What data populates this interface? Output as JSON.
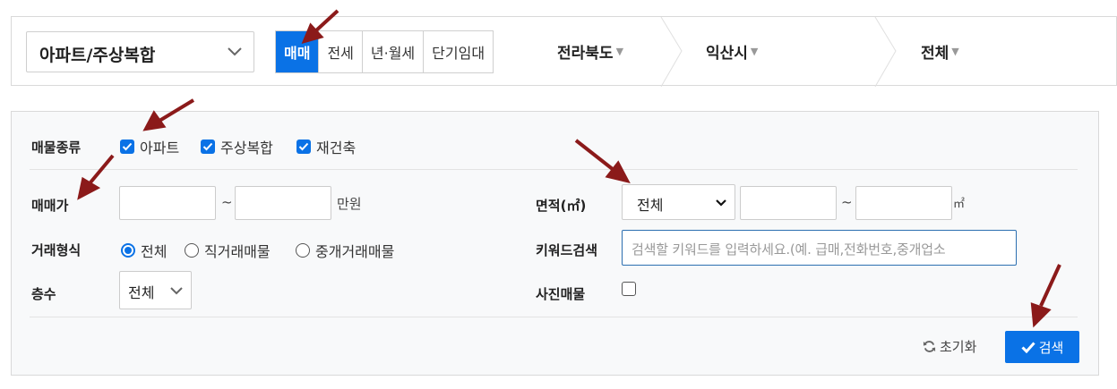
{
  "top": {
    "property_type": "아파트/주상복합",
    "deal_tabs": [
      "매매",
      "전세",
      "년·월세",
      "단기임대"
    ],
    "active_tab": "매매",
    "region": {
      "province": "전라북도",
      "city": "익산시",
      "district": "전체"
    }
  },
  "filters": {
    "property_kind": {
      "label": "매물종류",
      "options": [
        {
          "label": "아파트",
          "checked": true
        },
        {
          "label": "주상복합",
          "checked": true
        },
        {
          "label": "재건축",
          "checked": true
        }
      ]
    },
    "price": {
      "label": "매매가",
      "min": "",
      "max": "",
      "tilde": "~",
      "unit": "만원"
    },
    "area": {
      "label": "면적(㎡)",
      "select_value": "전체",
      "min": "",
      "max": "",
      "tilde": "~",
      "unit": "㎡"
    },
    "deal_form": {
      "label": "거래형식",
      "options": [
        {
          "label": "전체",
          "selected": true
        },
        {
          "label": "직거래매물",
          "selected": false
        },
        {
          "label": "중개거래매물",
          "selected": false
        }
      ]
    },
    "keyword": {
      "label": "키워드검색",
      "placeholder": "검색할 키워드를 입력하세요.(예. 급매,전화번호,중개업소"
    },
    "floor": {
      "label": "층수",
      "value": "전체"
    },
    "photo": {
      "label": "사진매물",
      "checked": false
    }
  },
  "actions": {
    "reset": "초기화",
    "search": "검색"
  },
  "colors": {
    "accent": "#0a72e6",
    "annotation_arrow": "#8b1a1a"
  },
  "icons": {
    "dropdown": "chevron-down-icon",
    "caret": "caret-down-icon",
    "reset": "refresh-icon",
    "search": "check-icon"
  }
}
